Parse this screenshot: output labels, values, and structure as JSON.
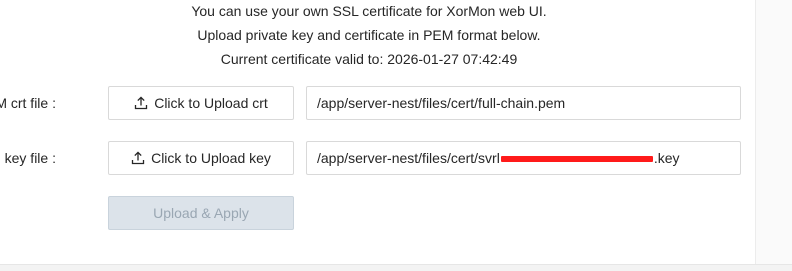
{
  "info": {
    "line1": "You can use your own SSL certificate for XorMon web UI.",
    "line2": "Upload private key and certificate in PEM format below.",
    "line3": "Current certificate valid to: 2026-01-27 07:42:49"
  },
  "crt": {
    "label": "PEM crt file :",
    "button_label": "Click to Upload crt",
    "path": "/app/server-nest/files/cert/full-chain.pem"
  },
  "key": {
    "label": "PEM key file :",
    "button_label": "Click to Upload key",
    "path_prefix": "/app/server-nest/files/cert/svrl",
    "path_suffix": ".key"
  },
  "apply": {
    "label": "Upload & Apply"
  },
  "icons": {
    "upload": "upload-icon"
  },
  "colors": {
    "text": "#262626",
    "border": "#d9d9d9",
    "disabled_bg": "#dce3ea",
    "disabled_text": "#9aa7b3",
    "redaction": "#ff1a1a"
  }
}
